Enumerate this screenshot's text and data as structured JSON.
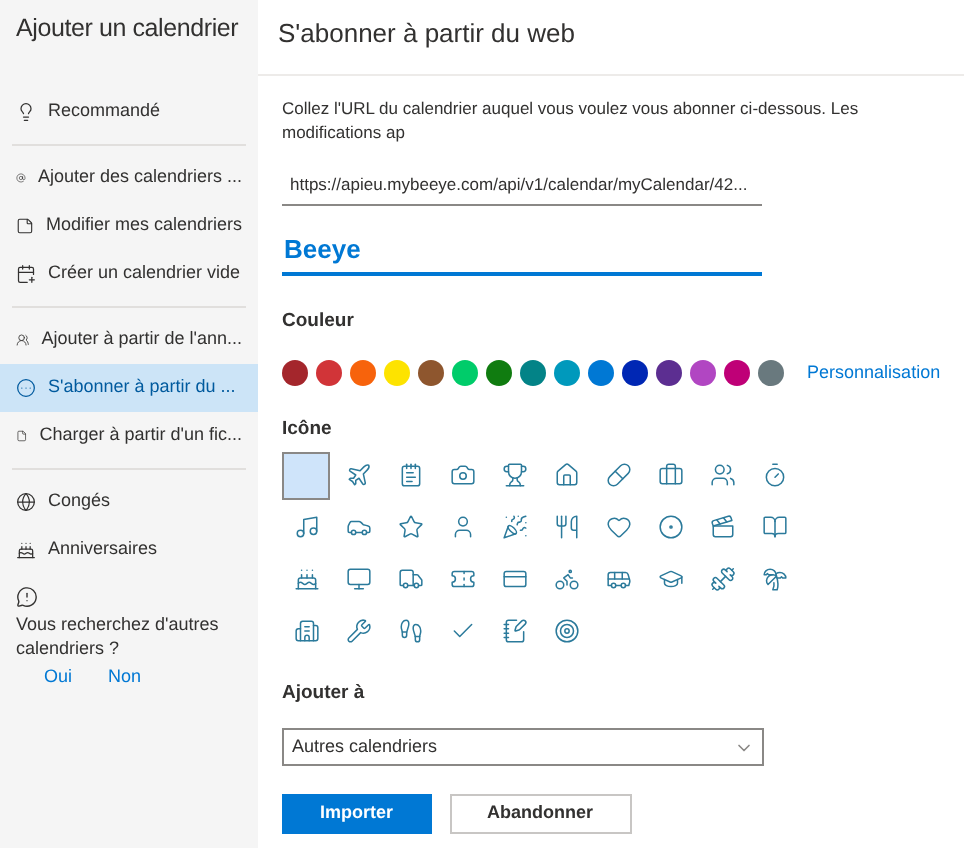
{
  "sidebar": {
    "title": "Ajouter un calendrier",
    "sections": [
      {
        "items": [
          {
            "label": "Recommandé",
            "selected": false
          }
        ]
      },
      {
        "items": [
          {
            "label": "Ajouter des calendriers ...",
            "selected": false
          },
          {
            "label": "Modifier mes calendriers",
            "selected": false
          },
          {
            "label": "Créer un calendrier vide",
            "selected": false
          }
        ]
      },
      {
        "items": [
          {
            "label": "Ajouter à partir de l'ann...",
            "selected": false
          },
          {
            "label": "S'abonner à partir du ...",
            "selected": true
          },
          {
            "label": "Charger à partir d'un fic...",
            "selected": false
          }
        ]
      },
      {
        "items": [
          {
            "label": "Congés",
            "selected": false
          },
          {
            "label": "Anniversaires",
            "selected": false
          }
        ]
      }
    ],
    "feedback": {
      "question": "Vous recherchez d'autres calendriers ?",
      "yes": "Oui",
      "no": "Non"
    }
  },
  "main": {
    "title": "S'abonner à partir du web",
    "description": "Collez l'URL du calendrier auquel vous voulez vous abonner ci-dessous. Les modifications ap",
    "url_field": {
      "value": "https://apieu.mybeeye.com/api/v1/calendar/myCalendar/42..."
    },
    "name_field": {
      "value": "Beeye"
    },
    "color_label": "Couleur",
    "colors": [
      {
        "color": "#a4262c"
      },
      {
        "color": "#d13438"
      },
      {
        "color": "#f7630c"
      },
      {
        "color": "#fde300"
      },
      {
        "color": "#8e562e"
      },
      {
        "color": "#00cc6a"
      },
      {
        "color": "#107c10"
      },
      {
        "color": "#038387"
      },
      {
        "color": "#0099bc"
      },
      {
        "color": "#0078d4"
      },
      {
        "color": "#0027b4"
      },
      {
        "color": "#5c2e91"
      },
      {
        "color": "#b146c2"
      },
      {
        "color": "#bf0077"
      },
      {
        "color": "#69797e"
      }
    ],
    "custom_color_link": "Personnalisation",
    "icon_label": "Icône",
    "icons": [
      {
        "selected": true
      },
      {
        "selected": false
      },
      {
        "selected": false
      },
      {
        "selected": false
      },
      {
        "selected": false
      },
      {
        "selected": false
      },
      {
        "selected": false
      },
      {
        "selected": false
      },
      {
        "selected": false
      },
      {
        "selected": false
      },
      {
        "selected": false
      },
      {
        "selected": false
      },
      {
        "selected": false
      },
      {
        "selected": false
      },
      {
        "selected": false
      },
      {
        "selected": false
      },
      {
        "selected": false
      },
      {
        "selected": false
      },
      {
        "selected": false
      },
      {
        "selected": false
      },
      {
        "selected": false
      },
      {
        "selected": false
      },
      {
        "selected": false
      },
      {
        "selected": false
      },
      {
        "selected": false
      },
      {
        "selected": false
      },
      {
        "selected": false
      },
      {
        "selected": false
      },
      {
        "selected": false
      },
      {
        "selected": false
      },
      {
        "selected": false
      },
      {
        "selected": false
      },
      {
        "selected": false
      },
      {
        "selected": false
      },
      {
        "selected": false
      },
      {
        "selected": false
      }
    ],
    "add_to_label": "Ajouter à",
    "add_to_select": {
      "value": "Autres calendriers"
    },
    "buttons": [
      {
        "label": "Importer",
        "kind": "primary"
      },
      {
        "label": "Abandonner",
        "kind": "secondary"
      }
    ]
  }
}
